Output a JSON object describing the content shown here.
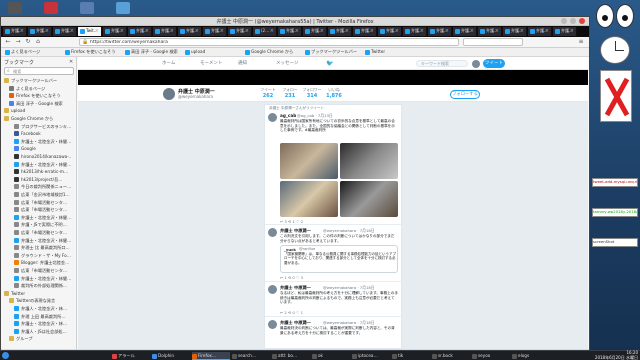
{
  "colors": {
    "twitter_blue": "#1da1f2",
    "desktop_bg": "#1e3f66",
    "taskbar_bg": "#1c1f24"
  },
  "window": {
    "title": "弁護士 中原潤一 (@weyernakahara55a) | Twitter - Mozilla Firefox"
  },
  "tabs": [
    "弁護…",
    "弁護…",
    "弁護…",
    "Twit…",
    "弁護…",
    "弁護…",
    "弁護…",
    "弁護…",
    "弁護…",
    "弁護…",
    "(2…",
    "弁護…",
    "弁護…",
    "弁護…",
    "弁護…",
    "弁護…",
    "弁護…",
    "弁護…",
    "弁護…",
    "弁護…",
    "弁護…",
    "弁護…",
    "弁護…"
  ],
  "nav": {
    "url": "https://twitter.com/weyernakahara",
    "back": "←",
    "forward": "→",
    "reload": "↻",
    "home": "⌂",
    "menu": "≡"
  },
  "bookmarks_toolbar": [
    "よく見るページ",
    "Firefox を使いこなそう",
    "高田 淳子 - Google 検索",
    "upload",
    "Google Chrome から",
    "ブックマークツールバー",
    "Twitter"
  ],
  "sidebar": {
    "header": "ブックマーク",
    "search_placeholder": "検索",
    "items": [
      {
        "label": "ブックマークツールバー",
        "icon": "folder-icon",
        "color": "#d9b44a",
        "indent": 0
      },
      {
        "label": "よく見るページ",
        "icon": "gear-icon",
        "color": "#777777",
        "indent": 1
      },
      {
        "label": "Firefox を使いこなそう",
        "icon": "firefox-icon",
        "color": "#e66000",
        "indent": 1
      },
      {
        "label": "高田 淳子 - Google 検索",
        "icon": "google-icon",
        "color": "#4285f4",
        "indent": 1
      },
      {
        "label": "upload",
        "icon": "folder-icon",
        "color": "#d9b44a",
        "indent": 0
      },
      {
        "label": "Google Chrome から",
        "icon": "folder-icon",
        "color": "#d9b44a",
        "indent": 0
      },
      {
        "label": "ブログサービスのランキ…",
        "icon": "page-icon",
        "color": "#888888",
        "indent": 2
      },
      {
        "label": "Facebook",
        "icon": "facebook-icon",
        "color": "#3b5998",
        "indent": 2
      },
      {
        "label": "弁護士・北陸金沢・林健…",
        "icon": "twitter-icon",
        "color": "#1da1f2",
        "indent": 2
      },
      {
        "label": "Google",
        "icon": "google-icon",
        "color": "#4285f4",
        "indent": 2
      },
      {
        "label": "hirono2014/kanazawa-…",
        "icon": "github-icon",
        "color": "#333333",
        "indent": 2
      },
      {
        "label": "弁護士・北陸金沢・林健…",
        "icon": "twitter-icon",
        "color": "#1da1f2",
        "indent": 2
      },
      {
        "label": "hk2013/hk-erratic-m…",
        "icon": "github-icon",
        "color": "#333333",
        "indent": 2
      },
      {
        "label": "hk2013/project/吾…",
        "icon": "github-icon",
        "color": "#333333",
        "indent": 2
      },
      {
        "label": "今日の裁判所関係ニュー…",
        "icon": "page-icon",
        "color": "#888888",
        "indent": 2
      },
      {
        "label": "広東「金沢市地域検討1…",
        "icon": "page-icon",
        "color": "#888888",
        "indent": 2
      },
      {
        "label": "広東「市場活動センタ…",
        "icon": "page-icon",
        "color": "#888888",
        "indent": 2
      },
      {
        "label": "広東「市場活動センタ…",
        "icon": "page-icon",
        "color": "#888888",
        "indent": 2
      },
      {
        "label": "弁護士・北陸金沢・林健…",
        "icon": "twitter-icon",
        "color": "#1da1f2",
        "indent": 2
      },
      {
        "label": "弁護・JSで実際に不明…",
        "icon": "page-icon",
        "color": "#888888",
        "indent": 2
      },
      {
        "label": "広東「市場活動センタ…",
        "icon": "page-icon",
        "color": "#888888",
        "indent": 2
      },
      {
        "label": "弁護士・北陸金沢・林健…",
        "icon": "twitter-icon",
        "color": "#1da1f2",
        "indent": 2
      },
      {
        "label": "弁理士 比 最高裁判所口…",
        "icon": "page-icon",
        "color": "#888888",
        "indent": 2
      },
      {
        "label": "グラウンド・ザ・My Fo…",
        "icon": "page-icon",
        "color": "#888888",
        "indent": 2
      },
      {
        "label": "Blogger: 弁護士北陸金…",
        "icon": "blogger-icon",
        "color": "#f57d00",
        "indent": 2
      },
      {
        "label": "広東「市場活動センタ…",
        "icon": "page-icon",
        "color": "#888888",
        "indent": 2
      },
      {
        "label": "弁護士・北陸金沢・林健…",
        "icon": "twitter-icon",
        "color": "#1da1f2",
        "indent": 2
      },
      {
        "label": "裁判所の外部処理関係…",
        "icon": "page-icon",
        "color": "#888888",
        "indent": 2
      },
      {
        "label": "Twitter",
        "icon": "folder-icon",
        "color": "#d9b44a",
        "indent": 0
      },
      {
        "label": "Twitterの表現な発言",
        "icon": "folder-icon",
        "color": "#d9b44a",
        "indent": 1
      },
      {
        "label": "弁護人・北陸金沢・林…",
        "icon": "twitter-icon",
        "color": "#1da1f2",
        "indent": 2
      },
      {
        "label": "弁理 上田 最高裁判所…",
        "icon": "twitter-icon",
        "color": "#1da1f2",
        "indent": 2
      },
      {
        "label": "弁護士・北陸金沢・林…",
        "icon": "twitter-icon",
        "color": "#1da1f2",
        "indent": 2
      },
      {
        "label": "弁護人・JSは社会部処…",
        "icon": "twitter-icon",
        "color": "#1da1f2",
        "indent": 2
      },
      {
        "label": "グループ",
        "icon": "folder-icon",
        "color": "#d9b44a",
        "indent": 1
      }
    ]
  },
  "twitter": {
    "nav_items": [
      "ホーム",
      "モーメント",
      "通知",
      "メッセージ"
    ],
    "search_placeholder": "キーワード検索",
    "tweet_button": "ツイート",
    "profile": {
      "name": "弁護士 中原潤一",
      "handle": "@weyernakahara",
      "follow_button": "フォローする",
      "stats": [
        {
          "label": "ツイート",
          "value": "262"
        },
        {
          "label": "フォロー",
          "value": "231"
        },
        {
          "label": "フォロワー",
          "value": "314"
        },
        {
          "label": "いいね",
          "value": "1,876"
        }
      ]
    },
    "retweet_label": "弁護士 中原潤一さんがリツイート",
    "tweets": [
      {
        "name": "ag_cab",
        "handle": "@ag_cab · 7月13日",
        "body": "最高裁判所は国家所有地についての初歩的な合意を基準として最高の合意を示しました。また、全国的な協議会との関係として判断の基準を示した事例です。#最高裁判所",
        "actions": "↩ 3   ⟲ 1   ♡ 2"
      },
      {
        "name": "弁護士 中原潤一",
        "handle": "@weyernakahara · 7月18日",
        "body": "この判決文を引用します。この件の判断についてはかなりの部分でまだ分からない点があると考えています。",
        "actions": "↩ 1   ⟲ 0   ♡ 3",
        "quote_name": "_yuck",
        "quote_handle": "@ranflue",
        "quote_body": "「国家機関等」は、単なる公務員に関する事務処理能力の話というアプローチを中心にしており、関連する部分として全体を十分に検討する必要がある。"
      },
      {
        "name": "弁護士 中原潤一",
        "handle": "@weyernakahara · 7月18日",
        "body": "なるほど、私は最高裁判所の考え方を十分に理解しています。事務上の手続きは最高裁判所の判断によるもので、実務上も注意が必要だと考えています。",
        "actions": "↩ 2   ⟲ 0   ♡ 1"
      },
      {
        "name": "弁護士 中原潤一",
        "handle": "@weyernakahara · 7月18日",
        "body": "最高裁判決の判断については、最高裁が実際に判断した内容と、その背景にある考え方を十分に検討することが重要です。",
        "actions": ""
      }
    ]
  },
  "widgets": {
    "term_lines": [
      "tweet-add-mysql-unq.rb",
      "tammy-wp2018y-2018/2",
      "screenShot"
    ]
  },
  "taskbar": {
    "items": [
      {
        "label": "アラール",
        "icon": "alarm-icon",
        "color": "#e04040"
      },
      {
        "label": "Dolphin",
        "icon": "folder-icon",
        "color": "#3a8ee6"
      },
      {
        "label": "Firefox…",
        "icon": "firefox-icon",
        "color": "#e66000"
      },
      {
        "label": "search…",
        "icon": "terminal-icon",
        "color": "#555555"
      },
      {
        "label": "attl: bo…",
        "icon": "terminal-icon",
        "color": "#555555"
      },
      {
        "label": "ok",
        "icon": "terminal-icon",
        "color": "#555555"
      },
      {
        "label": "iptocea…",
        "icon": "terminal-icon",
        "color": "#555555"
      },
      {
        "label": "tik",
        "icon": "terminal-icon",
        "color": "#555555"
      },
      {
        "label": "sr.bock",
        "icon": "terminal-icon",
        "color": "#555555"
      },
      {
        "label": "seyoo",
        "icon": "terminal-icon",
        "color": "#555555"
      },
      {
        "label": "elogs",
        "icon": "terminal-icon",
        "color": "#555555"
      }
    ],
    "time": "16:20",
    "date": "2018年6月20日 水曜日"
  }
}
